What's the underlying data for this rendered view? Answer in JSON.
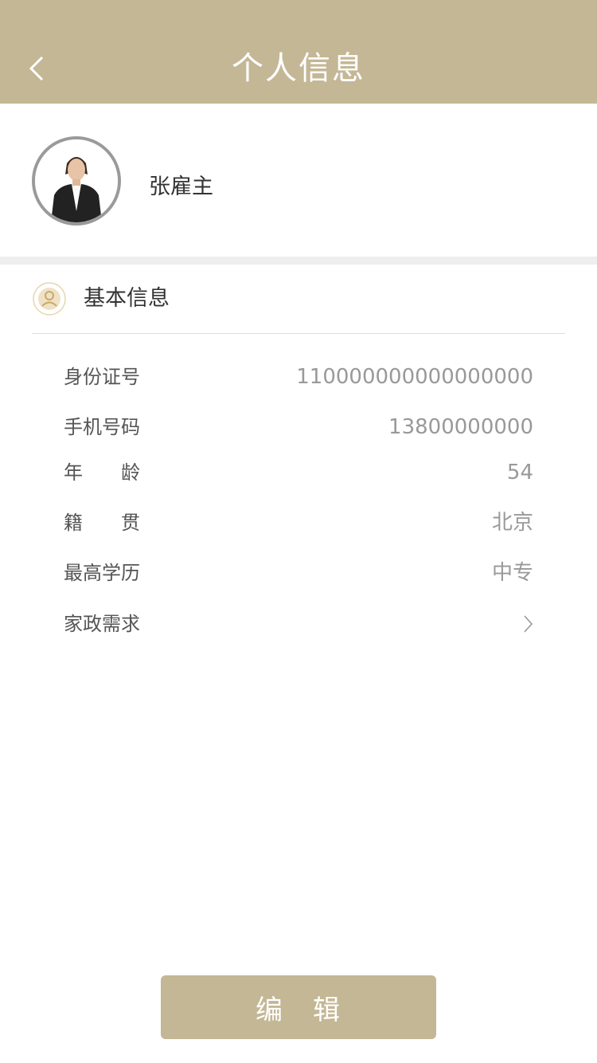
{
  "header": {
    "title": "个人信息",
    "back_icon": "chevron-left-icon"
  },
  "profile": {
    "name": "张雇主",
    "avatar": "avatar-photo"
  },
  "section": {
    "title": "基本信息",
    "icon": "user-circle-icon"
  },
  "fields": [
    {
      "label": "身份证号",
      "value": "110000000000000000"
    },
    {
      "label": "手机号码",
      "value": "13800000000"
    },
    {
      "label": "年　　龄",
      "value": "54"
    },
    {
      "label": "籍　　贯",
      "value": "北京"
    },
    {
      "label": "最高学历",
      "value": "中专"
    },
    {
      "label": "家政需求",
      "value": "",
      "icon": "chevron-right-icon"
    }
  ],
  "actions": {
    "edit_label": "编　辑"
  },
  "colors": {
    "primary": "#c4b795",
    "label": "#555555",
    "value": "#999999",
    "gap": "#eeeeee"
  }
}
